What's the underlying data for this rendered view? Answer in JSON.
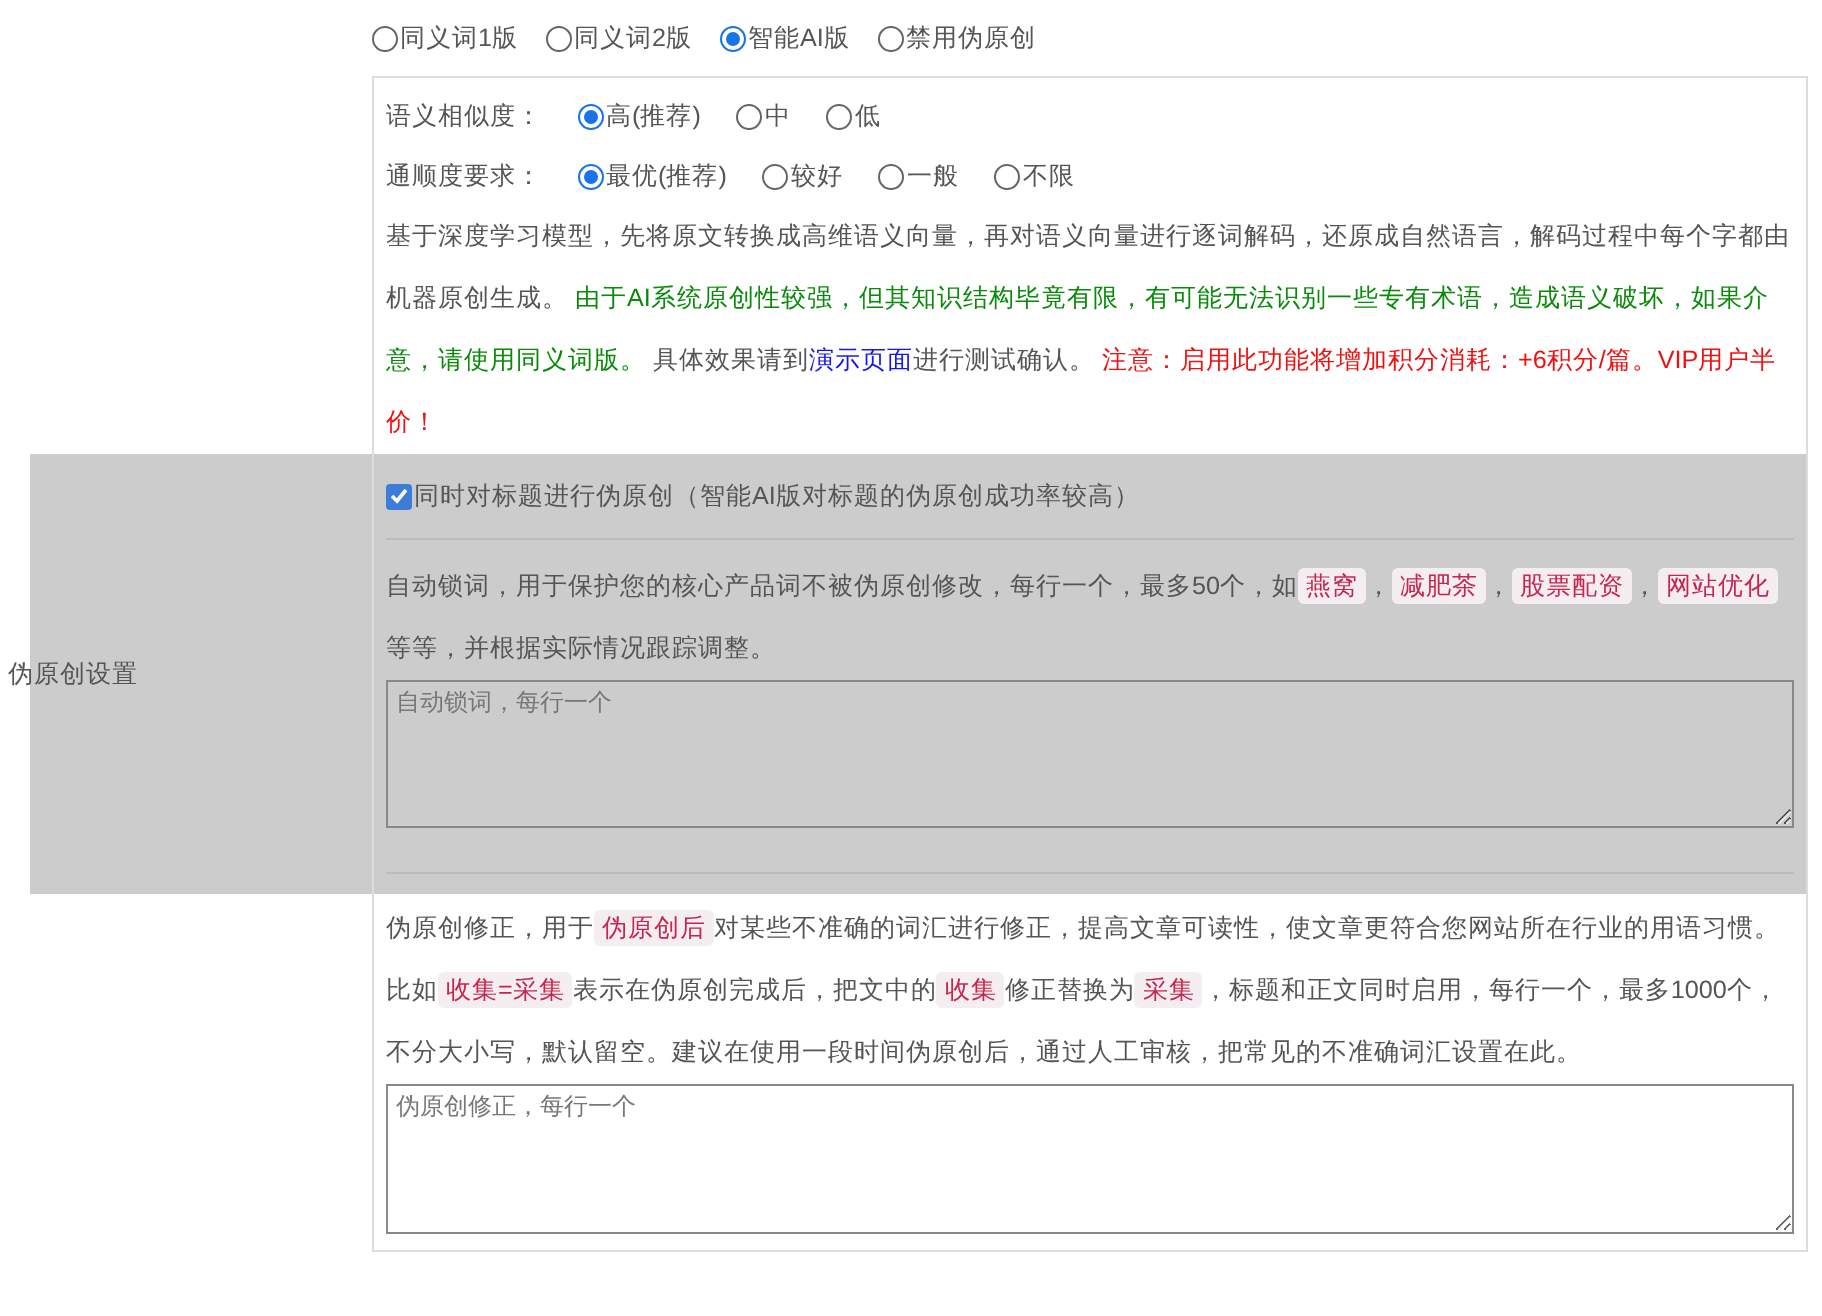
{
  "modes": [
    {
      "label": "同义词1版",
      "selected": false
    },
    {
      "label": "同义词2版",
      "selected": false
    },
    {
      "label": "智能AI版",
      "selected": true
    },
    {
      "label": "禁用伪原创",
      "selected": false
    }
  ],
  "similarity": {
    "label": "语义相似度：",
    "options": [
      {
        "label": "高(推荐)",
        "selected": true
      },
      {
        "label": "中",
        "selected": false
      },
      {
        "label": "低",
        "selected": false
      }
    ]
  },
  "fluency": {
    "label": "通顺度要求：",
    "options": [
      {
        "label": "最优(推荐)",
        "selected": true
      },
      {
        "label": "较好",
        "selected": false
      },
      {
        "label": "一般",
        "selected": false
      },
      {
        "label": "不限",
        "selected": false
      }
    ]
  },
  "description": [
    {
      "kind": "normal",
      "text": "基于深度学习模型，先将原文转换成高维语义向量，再对语义向量进行逐词解码，还原成自然语言，解码过程中每个字都由机器原创生成。 "
    },
    {
      "kind": "notice",
      "text": "由于AI系统原创性较强，但其知识结构毕竟有限，有可能无法识别一些专有术语，造成语义破坏，如果介意，请使用同义词版。"
    },
    {
      "kind": "normal",
      "text": " 具体效果请到"
    },
    {
      "kind": "link",
      "text": "演示页面"
    },
    {
      "kind": "normal",
      "text": "进行测试确认。 "
    },
    {
      "kind": "alert",
      "text": "注意：启用此功能将增加积分消耗：+6积分/篇。VIP用户半价！"
    }
  ],
  "section_label": "伪原创设置",
  "title_option": {
    "label": "同时对标题进行伪原创（智能AI版对标题的伪原创成功率较高）",
    "checked": true
  },
  "lock_words": {
    "intro": [
      {
        "kind": "text",
        "text": "自动锁词，用于保护您的核心产品词不被伪原创修改，每行一个，最多50个，如"
      },
      {
        "kind": "tag",
        "text": "燕窝"
      },
      {
        "kind": "text",
        "text": "，"
      },
      {
        "kind": "tag",
        "text": "减肥茶"
      },
      {
        "kind": "text",
        "text": "，"
      },
      {
        "kind": "tag",
        "text": "股票配资"
      },
      {
        "kind": "text",
        "text": "，"
      },
      {
        "kind": "tag",
        "text": "网站优化"
      },
      {
        "kind": "text",
        "text": " 等等，并根据实际情况跟踪调整。"
      }
    ],
    "placeholder": "自动锁词，每行一个"
  },
  "correction": {
    "intro": [
      {
        "kind": "text",
        "text": "伪原创修正，用于"
      },
      {
        "kind": "tag",
        "text": "伪原创后"
      },
      {
        "kind": "text",
        "text": "对某些不准确的词汇进行修正，提高文章可读性，使文章更符合您网站所在行业的用语习惯。比如"
      },
      {
        "kind": "tag",
        "text": "收集=采集"
      },
      {
        "kind": "text",
        "text": "表示在伪原创完成后，把文中的"
      },
      {
        "kind": "tag",
        "text": "收集"
      },
      {
        "kind": "text",
        "text": "修正替换为"
      },
      {
        "kind": "tag",
        "text": "采集"
      },
      {
        "kind": "text",
        "text": "，标题和正文同时启用，每行一个，最多1000个，不分大小写，默认留空。建议在使用一段时间伪原创后，通过人工审核，把常见的不准确词汇设置在此。"
      }
    ],
    "placeholder": "伪原创修正，每行一个"
  }
}
